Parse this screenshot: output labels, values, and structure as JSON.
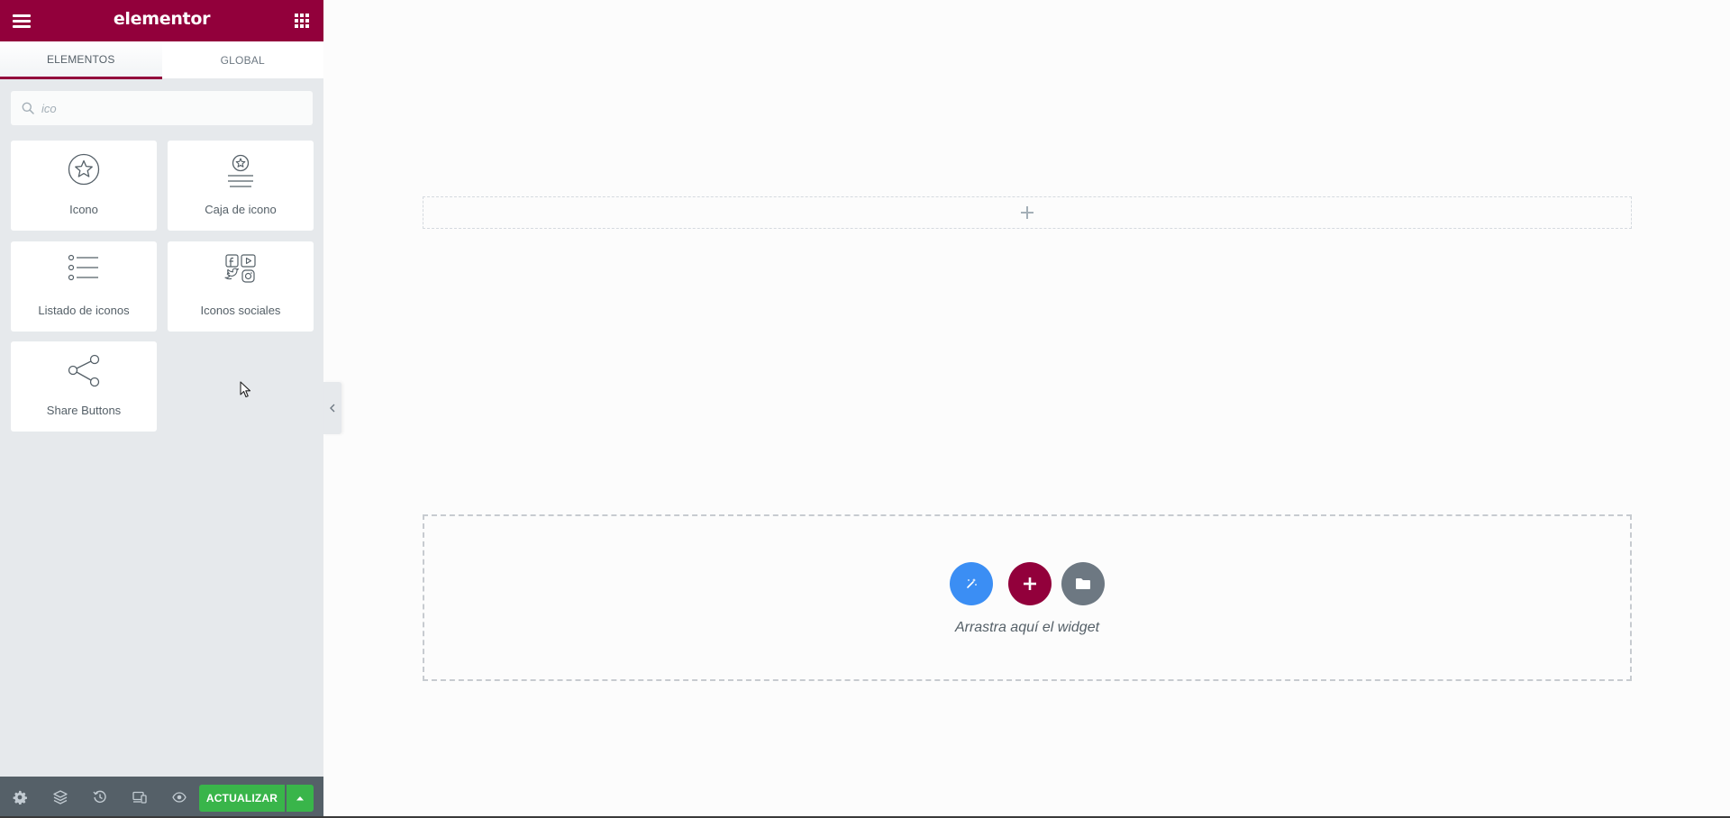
{
  "colors": {
    "brand": "#92003b",
    "panel_bg": "#e6e9ec",
    "footer_bg": "#556068",
    "update_green": "#39b54a",
    "ai_blue": "#3b8ef4",
    "template_gray": "#6d7882"
  },
  "header": {
    "brand": "elementor",
    "menu_icon": "hamburger-icon",
    "apps_icon": "grid-icon"
  },
  "tabs": [
    {
      "label": "ELEMENTOS",
      "active": true
    },
    {
      "label": "GLOBAL",
      "active": false
    }
  ],
  "search": {
    "value": "ico",
    "icon": "search-icon"
  },
  "widgets": [
    {
      "label": "Icono",
      "icon": "star-circle-icon"
    },
    {
      "label": "Caja de icono",
      "icon": "icon-box-icon"
    },
    {
      "label": "Listado de iconos",
      "icon": "icon-list-icon"
    },
    {
      "label": "Iconos sociales",
      "icon": "social-icons-icon"
    },
    {
      "label": "Share Buttons",
      "icon": "share-icon"
    }
  ],
  "footer": {
    "icons": [
      "settings-icon",
      "navigator-icon",
      "history-icon",
      "responsive-icon",
      "preview-icon"
    ],
    "update_label": "ACTUALIZAR",
    "update_menu_icon": "caret-up-icon"
  },
  "canvas": {
    "add_section_icon": "plus-icon",
    "drop_hint": "Arrastra aquí el widget",
    "buttons": [
      "ai-wand-icon",
      "add-section-icon",
      "template-library-icon"
    ]
  }
}
